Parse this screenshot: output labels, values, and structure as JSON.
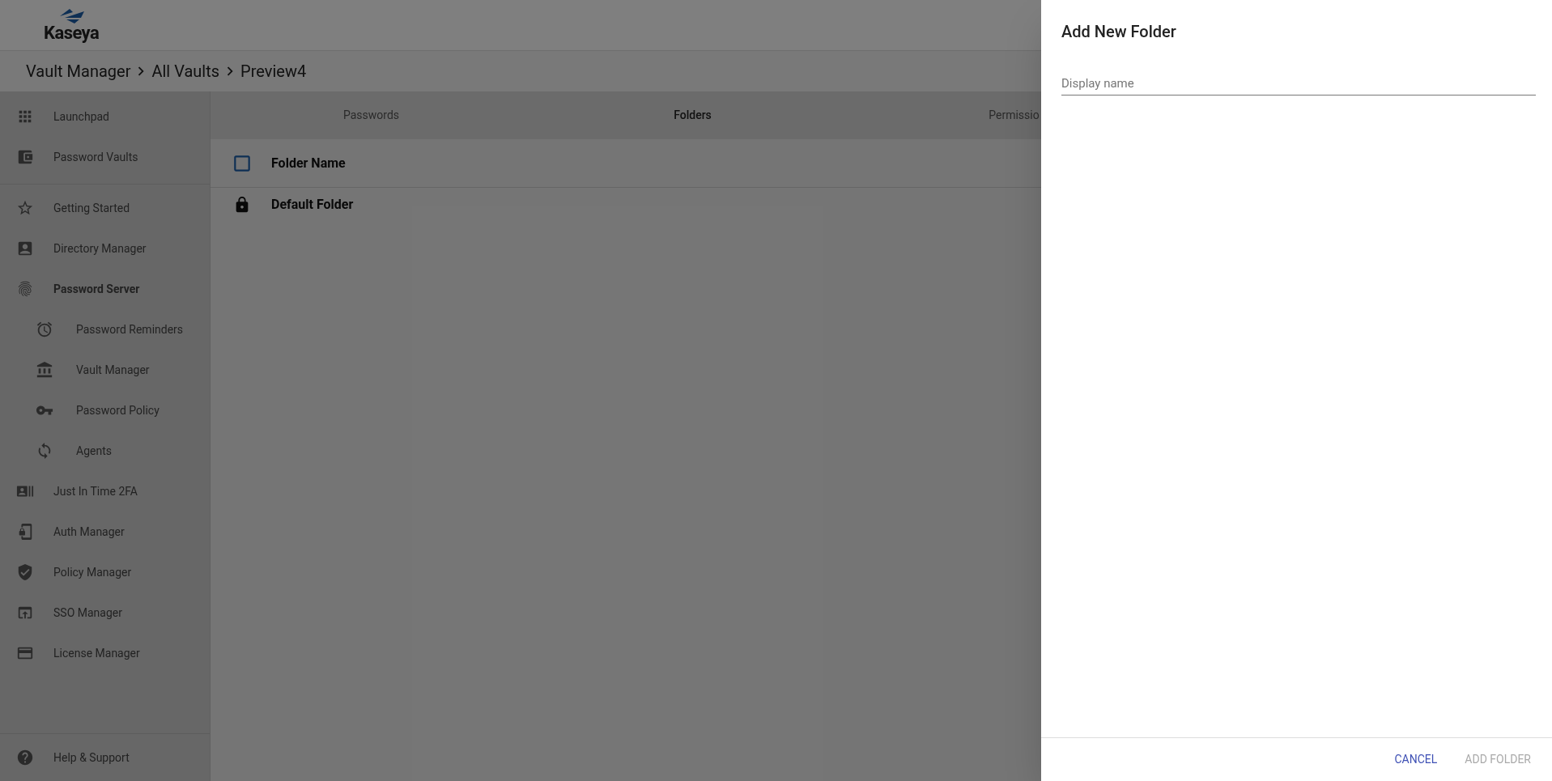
{
  "logo": {
    "text": "Kaseya"
  },
  "breadcrumb": [
    "Vault Manager",
    "All Vaults",
    "Preview4"
  ],
  "sidebar": {
    "top_items": [
      {
        "label": "Launchpad"
      },
      {
        "label": "Password Vaults"
      }
    ],
    "items": [
      {
        "label": "Getting Started",
        "expanded": false
      },
      {
        "label": "Directory Manager",
        "expanded": false
      },
      {
        "label": "Password Server",
        "expanded": true,
        "children": [
          {
            "label": "Password Reminders"
          },
          {
            "label": "Vault Manager"
          },
          {
            "label": "Password Policy"
          },
          {
            "label": "Agents"
          }
        ]
      },
      {
        "label": "Just In Time 2FA",
        "expanded": false
      },
      {
        "label": "Auth Manager",
        "expanded": false
      },
      {
        "label": "Policy Manager",
        "expanded": false
      },
      {
        "label": "SSO Manager",
        "expanded": false
      },
      {
        "label": "License Manager",
        "expanded": false
      }
    ],
    "footer_item": {
      "label": "Help & Support"
    }
  },
  "tabs": [
    {
      "label": "Passwords",
      "selected": false
    },
    {
      "label": "Folders",
      "selected": true
    },
    {
      "label": "Permissio",
      "selected": false
    }
  ],
  "table": {
    "select_all_checked": false,
    "columns": [
      "Folder Name"
    ],
    "rows": [
      {
        "name": "Default Folder",
        "locked": true
      }
    ]
  },
  "drawer": {
    "title": "Add New Folder",
    "field": {
      "placeholder": "Display name"
    },
    "buttons": [
      {
        "label": "CANCEL",
        "disabled": false
      },
      {
        "label": "ADD FOLDER",
        "disabled": true
      }
    ]
  }
}
